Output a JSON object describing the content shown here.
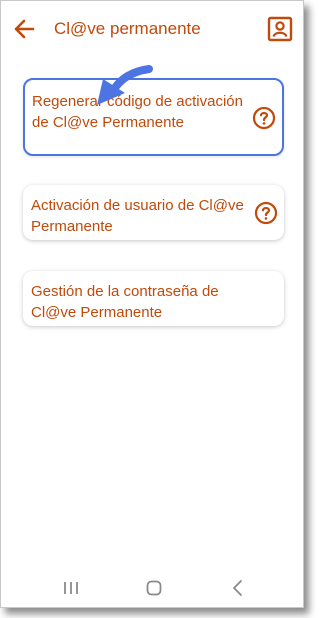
{
  "header": {
    "title": "Cl@ve permanente",
    "back_icon": "arrow-left-icon",
    "profile_icon": "contact-card-icon"
  },
  "options": [
    {
      "label": "Regenerar código de activación de Cl@ve Permanente",
      "help_icon": "question-circle-icon",
      "highlighted": true
    },
    {
      "label": "Activación de usuario de Cl@ve Permanente",
      "help_icon": "question-circle-icon",
      "highlighted": false
    },
    {
      "label": "Gestión de la contraseña de Cl@ve Permanente",
      "highlighted": false
    }
  ],
  "navbar": {
    "recents_icon": "recent-apps-icon",
    "home_icon": "home-icon",
    "back_icon": "nav-back-icon"
  },
  "colors": {
    "accent": "#c04a0b",
    "highlight_border": "#4d74e3",
    "pointer_arrow": "#4d74e3",
    "nav_icons": "#8a8a8a"
  }
}
